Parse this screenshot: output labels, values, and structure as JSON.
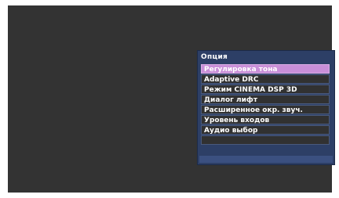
{
  "menu": {
    "title": "Опция",
    "items": [
      {
        "label": "Регулировка тона",
        "selected": true
      },
      {
        "label": "Adaptive DRC",
        "selected": false
      },
      {
        "label": "Режим CINEMA DSP 3D",
        "selected": false
      },
      {
        "label": "Диалог лифт",
        "selected": false
      },
      {
        "label": "Расширенное окр. звуч.",
        "selected": false
      },
      {
        "label": "Уровень входов",
        "selected": false
      },
      {
        "label": "Аудио выбор",
        "selected": false
      },
      {
        "label": "",
        "selected": false
      }
    ]
  },
  "colors": {
    "screen_background": "#333333",
    "panel_background": "#2d3f66",
    "highlight": "#c98fd8",
    "item_background": "#313131"
  }
}
